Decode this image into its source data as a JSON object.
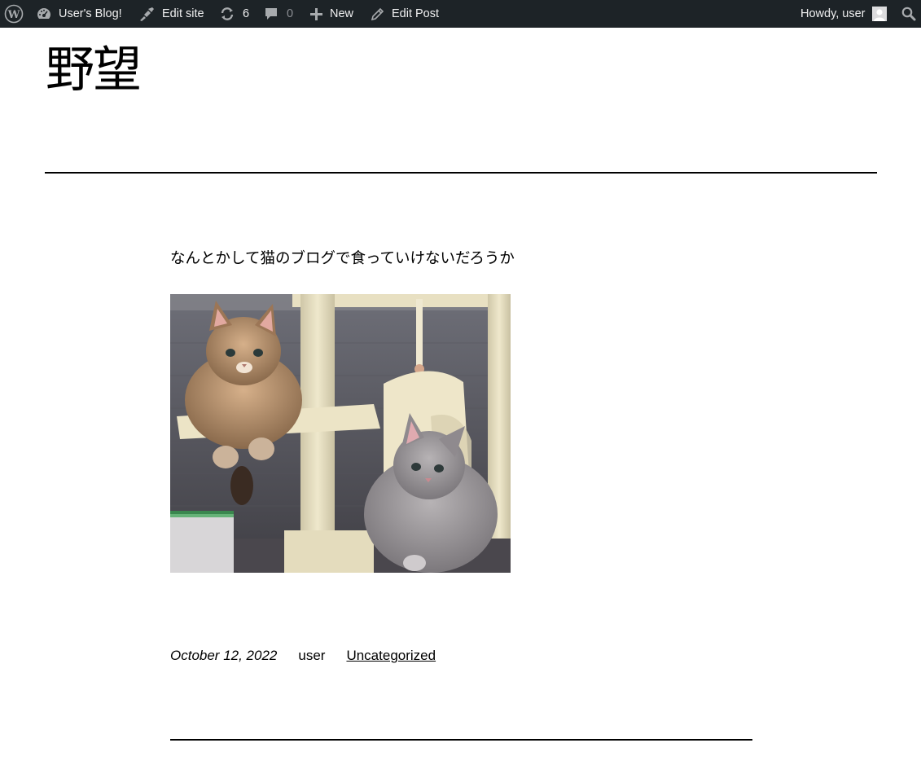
{
  "admin_bar": {
    "site_name": "User's Blog!",
    "edit_site": "Edit site",
    "updates_count": "6",
    "comments_count": "0",
    "new_label": "New",
    "edit_post": "Edit Post",
    "howdy": "Howdy, user"
  },
  "site": {
    "title": "野望"
  },
  "post": {
    "text": "なんとかして猫のブログで食っていけないだろうか",
    "image_alt": "Two cats on a cat tower",
    "date": "October 12, 2022",
    "author": "user",
    "category": "Uncategorized"
  },
  "colors": {
    "admin_bar_bg": "#1d2327",
    "admin_bar_text": "#f0f0f1",
    "admin_bar_dim": "#8c8f94",
    "page_bg": "#ffffff",
    "text": "#000000"
  }
}
